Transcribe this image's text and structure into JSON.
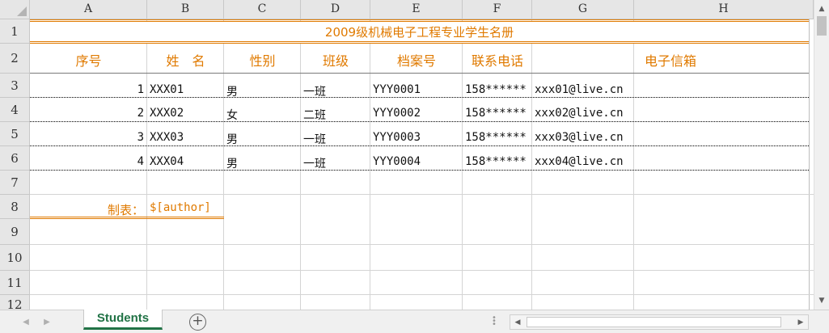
{
  "columns": [
    "A",
    "B",
    "C",
    "D",
    "E",
    "F",
    "G",
    "H"
  ],
  "rows": [
    "1",
    "2",
    "3",
    "4",
    "5",
    "6",
    "7",
    "8",
    "9",
    "10",
    "11",
    "12"
  ],
  "sheet": {
    "title": "2009级机械电子工程专业学生名册",
    "headers": [
      "序号",
      "姓　名",
      "性别",
      "班级",
      "档案号",
      "联系电话",
      "电子信箱"
    ],
    "records": [
      {
        "no": "1",
        "name": "XXX01",
        "gender": "男",
        "class": "一班",
        "file_no": "YYY0001",
        "phone": "158******",
        "email": "xxx01@live.cn"
      },
      {
        "no": "2",
        "name": "XXX02",
        "gender": "女",
        "class": "二班",
        "file_no": "YYY0002",
        "phone": "158******",
        "email": "xxx02@live.cn"
      },
      {
        "no": "3",
        "name": "XXX03",
        "gender": "男",
        "class": "一班",
        "file_no": "YYY0003",
        "phone": "158******",
        "email": "xxx03@live.cn"
      },
      {
        "no": "4",
        "name": "XXX04",
        "gender": "男",
        "class": "一班",
        "file_no": "YYY0004",
        "phone": "158******",
        "email": "xxx04@live.cn"
      }
    ],
    "maker_label": "制表：",
    "maker_value": "$[author]"
  },
  "tabs": {
    "active": "Students",
    "add_label": "+"
  },
  "colors": {
    "accent": "#e07a00",
    "tab_green": "#217346"
  }
}
